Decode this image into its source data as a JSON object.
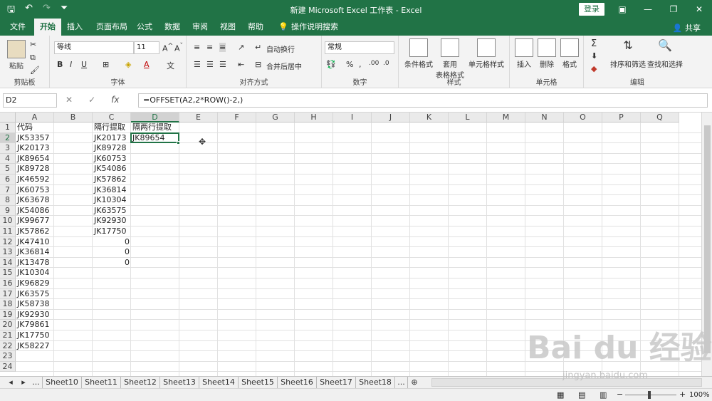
{
  "window": {
    "title": "新建 Microsoft Excel 工作表 - Excel",
    "login_label": "登录",
    "share_label": "共享"
  },
  "tabs": [
    "文件",
    "开始",
    "插入",
    "页面布局",
    "公式",
    "数据",
    "审阅",
    "视图",
    "帮助",
    "操作说明搜索"
  ],
  "active_tab": "开始",
  "ribbon": {
    "clipboard": {
      "paste": "粘贴",
      "label": "剪贴板"
    },
    "font": {
      "name": "等线",
      "size": "11",
      "label": "字体"
    },
    "align": {
      "wrap": "自动换行",
      "merge": "合并后居中",
      "label": "对齐方式"
    },
    "number": {
      "format": "常规",
      "label": "数字"
    },
    "styles": {
      "cond": "条件格式",
      "table1": "套用",
      "table2": "表格格式",
      "cell": "单元格样式",
      "label": "样式"
    },
    "cells": {
      "insert": "插入",
      "delete": "删除",
      "format": "格式",
      "label": "单元格"
    },
    "edit": {
      "sort": "排序和筛选",
      "find": "查找和选择",
      "label": "编辑"
    }
  },
  "formula_bar": {
    "name_box": "D2",
    "formula": "=OFFSET(A2,2*ROW()-2,)"
  },
  "columns": [
    "A",
    "B",
    "C",
    "D",
    "E",
    "F",
    "G",
    "H",
    "I",
    "J",
    "K",
    "L",
    "M",
    "N",
    "O",
    "P",
    "Q"
  ],
  "rows": [
    "1",
    "2",
    "3",
    "4",
    "5",
    "6",
    "7",
    "8",
    "9",
    "10",
    "11",
    "12",
    "13",
    "14",
    "15",
    "16",
    "17",
    "18",
    "19",
    "20",
    "21",
    "22",
    "23",
    "24"
  ],
  "col_a": [
    "代码",
    "JK53357",
    "JK20173",
    "JK89654",
    "JK89728",
    "JK46592",
    "JK60753",
    "JK63678",
    "JK54086",
    "JK99677",
    "JK57862",
    "JK47410",
    "JK36814",
    "JK13478",
    "JK10304",
    "JK96829",
    "JK63575",
    "JK58738",
    "JK92930",
    "JK79861",
    "JK17750",
    "JK58227"
  ],
  "col_c": [
    "隔行提取",
    "JK20173",
    "JK89728",
    "JK60753",
    "JK54086",
    "JK57862",
    "JK36814",
    "JK10304",
    "JK63575",
    "JK92930",
    "JK17750"
  ],
  "col_c_zeros": [
    "0",
    "0",
    "0"
  ],
  "col_d": [
    "隔两行提取",
    "JK89654"
  ],
  "sheets": [
    "Sheet10",
    "Sheet11",
    "Sheet12",
    "Sheet13",
    "Sheet14",
    "Sheet15",
    "Sheet16",
    "Sheet17",
    "Sheet18"
  ],
  "zoom": "100%",
  "watermark": {
    "main": "Bai du 经验",
    "sub": "jingyan.baidu.com"
  },
  "colors": {
    "excel_green": "#217346"
  }
}
